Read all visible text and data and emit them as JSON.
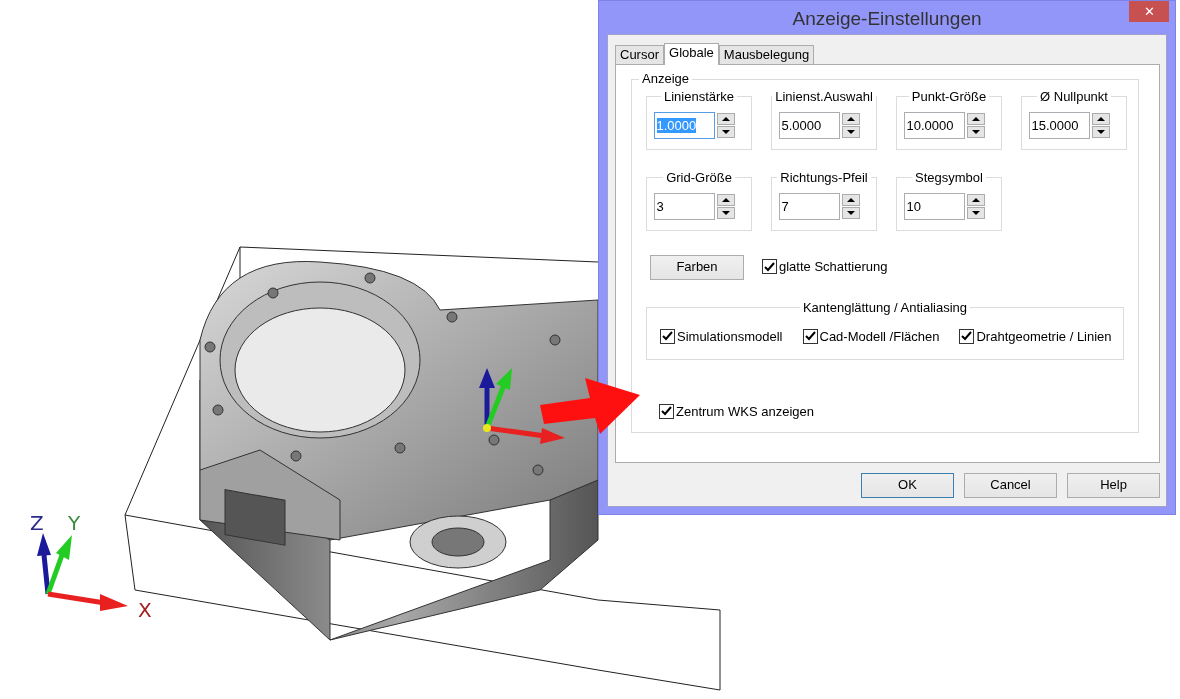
{
  "viewport": {
    "axis_labels": [
      "Z",
      "Y",
      "X"
    ]
  },
  "dialog": {
    "title": "Anzeige-Einstellungen",
    "close_label": "✕",
    "tabs": [
      {
        "label": "Cursor",
        "selected": false
      },
      {
        "label": "Globale",
        "selected": true
      },
      {
        "label": "Mausbelegung",
        "selected": false
      }
    ],
    "group_title": "Anzeige",
    "spinners": [
      {
        "label": "Linienstärke",
        "value": "1.0000",
        "selected": true
      },
      {
        "label": "Linienst.Auswahl",
        "value": "5.0000",
        "selected": false
      },
      {
        "label": "Punkt-Größe",
        "value": "10.0000",
        "selected": false
      },
      {
        "label": "Ø Nullpunkt",
        "value": "15.0000",
        "selected": false
      },
      {
        "label": "Grid-Größe",
        "value": "3",
        "selected": false
      },
      {
        "label": "Richtungs-Pfeil",
        "value": "7",
        "selected": false
      },
      {
        "label": "Stegsymbol",
        "value": "10",
        "selected": false
      }
    ],
    "colors_button": "Farben",
    "smooth_shading": {
      "label": "glatte Schattierung",
      "checked": true
    },
    "antialiasing": {
      "title": "Kantenglättung / Antialiasing",
      "options": [
        {
          "label": "Simulationsmodell",
          "checked": true
        },
        {
          "label": "Cad-Modell /Flächen",
          "checked": true
        },
        {
          "label": "Drahtgeometrie / Linien",
          "checked": true
        }
      ]
    },
    "show_center": {
      "label": "Zentrum WKS anzeigen",
      "checked": true
    },
    "buttons": [
      {
        "label": "OK",
        "default": true
      },
      {
        "label": "Cancel",
        "default": false
      },
      {
        "label": "Help",
        "default": false
      }
    ]
  }
}
